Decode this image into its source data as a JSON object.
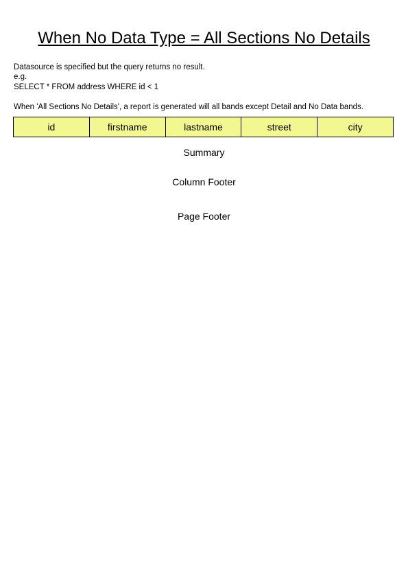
{
  "title": "When No Data Type = All Sections No Details",
  "description": {
    "line1": "Datasource is specified but the query returns no result.",
    "line2": "e.g.",
    "line3": "SELECT * FROM address WHERE id < 1",
    "line4": "When 'All Sections No Details', a report is generated will all bands except Detail and No Data bands."
  },
  "column_header": {
    "columns": [
      "id",
      "firstname",
      "lastname",
      "street",
      "city"
    ],
    "background_color": "#f3f78f"
  },
  "bands": {
    "summary": "Summary",
    "column_footer": "Column Footer",
    "page_footer": "Page Footer"
  }
}
